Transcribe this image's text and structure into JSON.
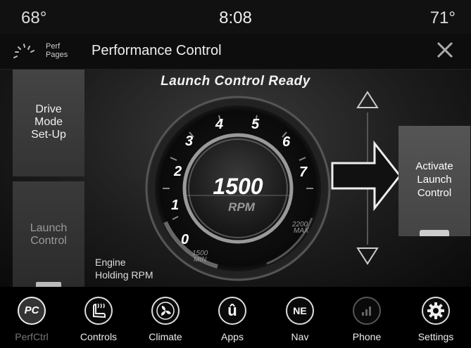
{
  "status": {
    "temp_left": "68°",
    "clock": "8:08",
    "temp_right": "71°"
  },
  "titlebar": {
    "perf_pages_line1": "Perf",
    "perf_pages_line2": "Pages",
    "title": "Performance Control"
  },
  "main": {
    "ready_text": "Launch Control Ready",
    "drive_mode": [
      "Drive",
      "Mode",
      "Set-Up"
    ],
    "launch_control": [
      "Launch",
      "Control"
    ],
    "activate": [
      "Activate",
      "Launch",
      "Control"
    ],
    "engine_label": [
      "Engine",
      "Holding RPM"
    ],
    "gauge": {
      "value": "1500",
      "unit": "RPM",
      "ticks": [
        "0",
        "1",
        "2",
        "3",
        "4",
        "5",
        "6",
        "7"
      ],
      "min_label": [
        "1500",
        "MIN"
      ],
      "max_label": [
        "2200",
        "MAX"
      ]
    }
  },
  "dock": [
    {
      "label": "PerfCtrl",
      "icon": "pc-icon",
      "glyph": "PC"
    },
    {
      "label": "Controls",
      "icon": "seat-heat-icon",
      "glyph": ""
    },
    {
      "label": "Climate",
      "icon": "fan-icon",
      "glyph": ""
    },
    {
      "label": "Apps",
      "icon": "apps-icon",
      "glyph": "û"
    },
    {
      "label": "Nav",
      "icon": "compass-icon",
      "glyph": "NE"
    },
    {
      "label": "Phone",
      "icon": "phone-signal-icon",
      "glyph": ""
    },
    {
      "label": "Settings",
      "icon": "gear-icon",
      "glyph": ""
    }
  ]
}
